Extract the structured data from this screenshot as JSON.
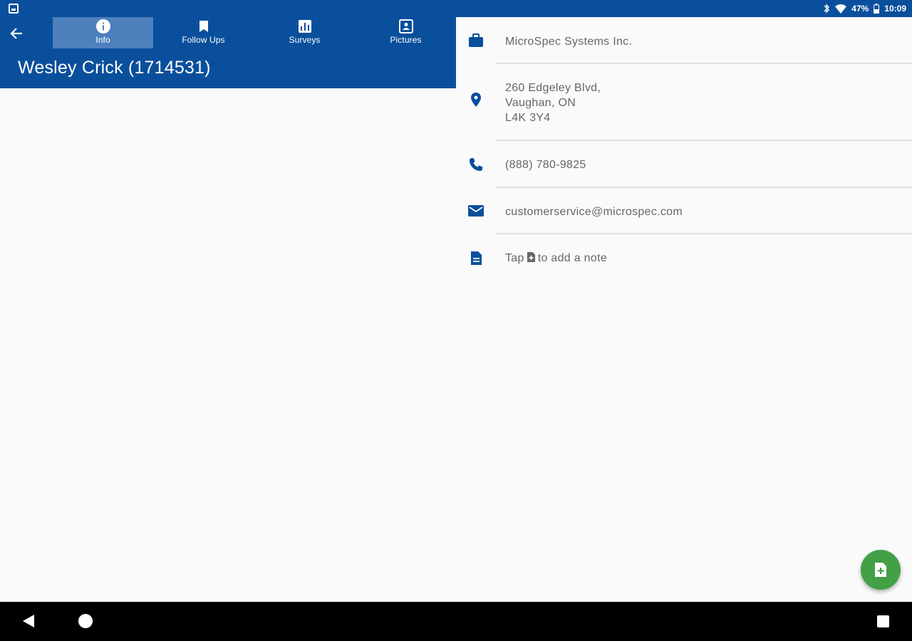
{
  "status_bar": {
    "battery": "47%",
    "time": "10:09"
  },
  "header": {
    "title": "Wesley Crick (1714531)",
    "tabs": [
      {
        "label": "Info",
        "icon": "info-icon",
        "active": true
      },
      {
        "label": "Follow Ups",
        "icon": "bookmark-icon",
        "active": false
      },
      {
        "label": "Surveys",
        "icon": "survey-icon",
        "active": false
      },
      {
        "label": "Pictures",
        "icon": "pictures-icon",
        "active": false
      }
    ]
  },
  "details": {
    "company": "MicroSpec Systems Inc.",
    "address": {
      "line1": "260 Edgeley Blvd,",
      "line2": "Vaughan, ON",
      "line3": "L4K 3Y4"
    },
    "phone": "(888) 780-9825",
    "email": "customerservice@microspec.com",
    "note": {
      "prefix": "Tap",
      "suffix": "to add a note"
    }
  },
  "colors": {
    "primary": "#0a4f9c",
    "active_tab": "#4d80bd",
    "fab": "#43a047",
    "text": "#666666"
  }
}
